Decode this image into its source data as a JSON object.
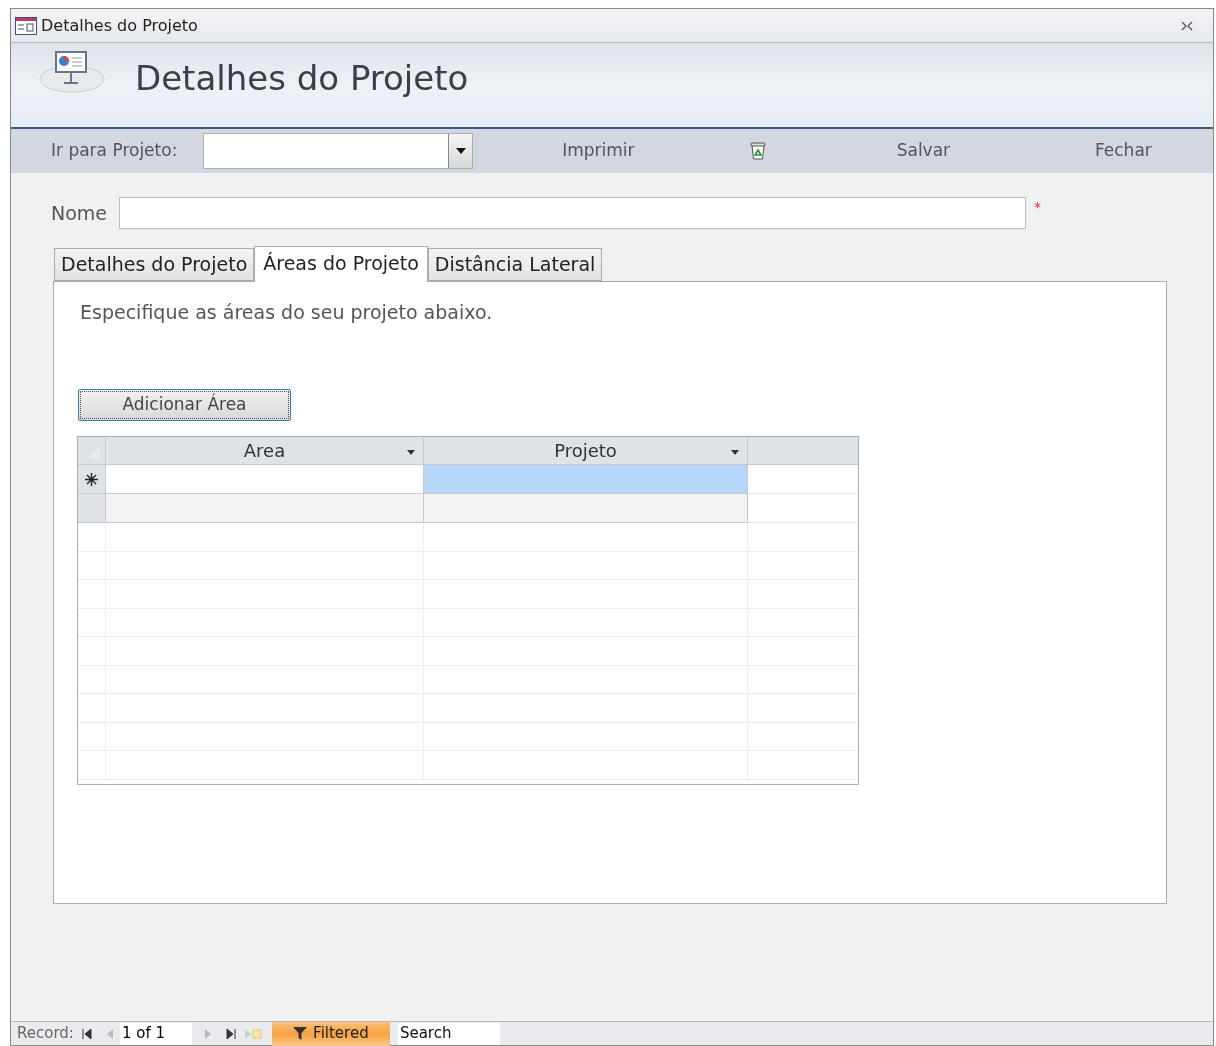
{
  "window": {
    "title": "Detalhes do Projeto"
  },
  "header": {
    "title": "Detalhes do Projeto"
  },
  "toolbar": {
    "goto_label": "Ir para Projeto:",
    "buttons": [
      {
        "kind": "text",
        "label": "Imprimir"
      },
      {
        "kind": "icon"
      },
      {
        "kind": "text",
        "label": "Salvar"
      },
      {
        "kind": "text",
        "label": "Fechar"
      }
    ]
  },
  "name_field": {
    "label": "Nome",
    "required_mark": "*"
  },
  "tabs": [
    {
      "label": "Detalhes do Projeto",
      "selected": false
    },
    {
      "label": "Áreas do Projeto",
      "selected": true
    },
    {
      "label": "Distância Lateral",
      "selected": false
    }
  ],
  "panel": {
    "instruction": "Especifique as áreas do seu projeto abaixo.",
    "add_button": "Adicionar Área",
    "datasheet": {
      "columns": [
        "Area",
        "Projeto"
      ],
      "rows": [
        {
          "kind": "new",
          "cells": [
            {
              "selected": false
            },
            {
              "selected": true
            }
          ]
        },
        {
          "kind": "blank",
          "cells": [
            {
              "selected": false
            },
            {
              "selected": false
            }
          ]
        }
      ]
    }
  },
  "status_bar": {
    "record_label": "Record:",
    "position": "1 of 1",
    "filter": {
      "label": "Filtered",
      "on": true
    },
    "search_placeholder": "Search"
  }
}
